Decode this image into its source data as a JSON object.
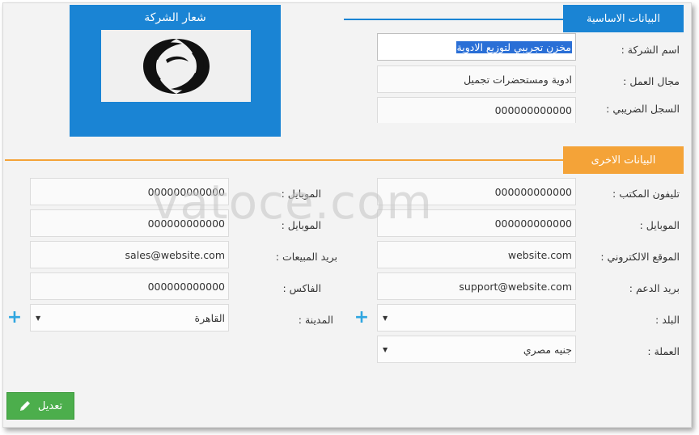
{
  "sections": {
    "basic_title": "البيانات الاساسية",
    "other_title": "البيانات الاخرى",
    "basic_color": "#1a84d4",
    "other_color": "#f4a338"
  },
  "logo": {
    "title": "شعار الشركة"
  },
  "basic": {
    "company_name_label": "اسم الشركة :",
    "company_name_value": "مخزن تجريبي لتوزيع الادوية",
    "field_label": "مجال العمل :",
    "field_value": "ادوية ومستحضرات تجميل",
    "tax_label": "السجل الضريبي :",
    "tax_value": "000000000000"
  },
  "other": {
    "office_phone_label": "تليفون المكتب :",
    "office_phone_value": "000000000000",
    "mobile1_label": "الموبايل :",
    "mobile1_value": "000000000000",
    "mobile2_label": "الموبايل :",
    "mobile2_value": "000000000000",
    "mobile3_label": "الموبايل :",
    "mobile3_value": "000000000000",
    "website_label": "الموقع الالكتروني :",
    "website_value": "website.com",
    "sales_email_label": "بريد المبيعات :",
    "sales_email_value": "sales@website.com",
    "support_email_label": "بريد الدعم :",
    "support_email_value": "support@website.com",
    "fax_label": "الفاكس :",
    "fax_value": "000000000000",
    "country_label": "البلد :",
    "country_value": "",
    "city_label": "المدينة :",
    "city_value": "القاهرة",
    "currency_label": "العملة :",
    "currency_value": "جنيه مصري"
  },
  "watermark": "vatoce.com",
  "actions": {
    "edit_label": "تعديل"
  },
  "icons": {
    "plus": "+",
    "caret": "▼",
    "edit": "pencil-icon"
  }
}
